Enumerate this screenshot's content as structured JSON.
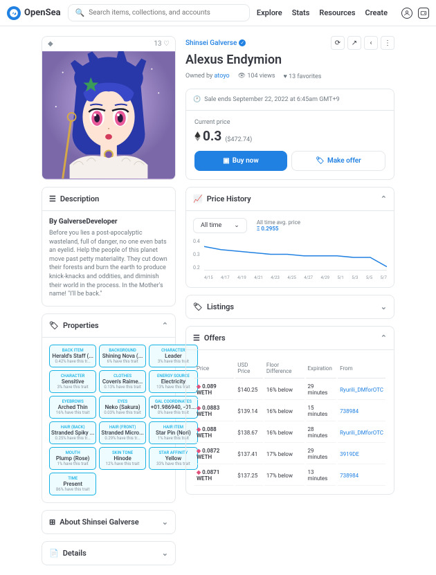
{
  "header": {
    "brand": "OpenSea",
    "search_placeholder": "Search items, collections, and accounts",
    "nav": [
      "Explore",
      "Stats",
      "Resources",
      "Create"
    ]
  },
  "artwork_bar": {
    "chain": "◆",
    "likes": "13 ♡"
  },
  "collection": "Shinsei Galverse",
  "title": "Alexus Endymion",
  "owner_prefix": "Owned by ",
  "owner": "atoyo",
  "views": "104 views",
  "favorites": "13 favorites",
  "sale_end": "Sale ends September 22, 2022 at 6:45am GMT+9",
  "price_label": "Current price",
  "price": "0.3",
  "price_usd": "($472.74)",
  "buy": "Buy now",
  "offer": "Make offer",
  "sections": {
    "description": "Description",
    "properties": "Properties",
    "about": "About Shinsei Galverse",
    "details": "Details",
    "price_history": "Price History",
    "listings": "Listings",
    "offers": "Offers"
  },
  "desc_author": "By GalverseDeveloper",
  "desc_text": "Before you lies a post-apocalyptic wasteland, full of danger, no one even bats an eyelid. Help the people of this planet move past petty materiality. They cut down their forests and burn the earth to produce knick-knacks and oddities, and diminish their world in the process. In the Mother's name! \"I'll be back.\"",
  "properties": [
    {
      "t": "BACK ITEM",
      "v": "Herald's Staff (...",
      "r": "0.42% have this tr..."
    },
    {
      "t": "BACKGROUND",
      "v": "Shining Nova (...",
      "r": "6% have this trait"
    },
    {
      "t": "CHARACTER",
      "v": "Leader",
      "r": "3% have this trait"
    },
    {
      "t": "CHARACTER",
      "v": "Sensitive",
      "r": "3% have this trait"
    },
    {
      "t": "CLOTHES",
      "v": "Coven's Raime...",
      "r": "0.13% have this trait"
    },
    {
      "t": "ENERGY SOURCE",
      "v": "Electricity",
      "r": "13% have this trait"
    },
    {
      "t": "EYEBROWS",
      "v": "Arched Thin",
      "r": "16% have this trait"
    },
    {
      "t": "EYES",
      "v": "Neko (Sakura)",
      "r": "0.03% have this trait"
    },
    {
      "t": "GAL COORDINATES",
      "v": "+01.986940, -01...",
      "r": "0% have this trait"
    },
    {
      "t": "HAIR (BACK)",
      "v": "Stranded Spiky ...",
      "r": "0.25% have this tr..."
    },
    {
      "t": "HAIR (FRONT)",
      "v": "Stranded Micro...",
      "r": "0.29% have this tr..."
    },
    {
      "t": "HAIR ITEM",
      "v": "Star Pin (Nori)",
      "r": "1% have this trait"
    },
    {
      "t": "MOUTH",
      "v": "Plump (Rose)",
      "r": "1% have this trait"
    },
    {
      "t": "SKIN TONE",
      "v": "Hinode",
      "r": "12% have this trait"
    },
    {
      "t": "STAR AFFINITY",
      "v": "Yellow",
      "r": "33% have this trait"
    },
    {
      "t": "TIME",
      "v": "Present",
      "r": "86% have this trait"
    }
  ],
  "time_filter": "All time",
  "avg_label": "All time avg. price",
  "avg_value": "Ξ 0.2955",
  "offers_headers": [
    "Price",
    "USD Price",
    "Floor Difference",
    "Expiration",
    "From"
  ],
  "offers": [
    {
      "p": "0.089 WETH",
      "u": "$140.25",
      "f": "16% below",
      "e": "29 minutes",
      "from": "Ryurili_DMforOTC"
    },
    {
      "p": "0.0883 WETH",
      "u": "$139.14",
      "f": "16% below",
      "e": "15 minutes",
      "from": "738984"
    },
    {
      "p": "0.088 WETH",
      "u": "$138.67",
      "f": "16% below",
      "e": "28 minutes",
      "from": "Ryurili_DMforOTC"
    },
    {
      "p": "0.0872 WETH",
      "u": "$137.41",
      "f": "17% below",
      "e": "29 minutes",
      "from": "3919DE"
    },
    {
      "p": "0.0871 WETH",
      "u": "$137.25",
      "f": "17% below",
      "e": "13 minutes",
      "from": "738984"
    }
  ],
  "chart_data": {
    "type": "line",
    "title": "Price History",
    "xlabel": "",
    "ylabel": "",
    "ylim": [
      0.2,
      0.4
    ],
    "yticks": [
      0.2,
      0.3,
      0.4
    ],
    "x": [
      "4/15",
      "4/17",
      "4/19",
      "4/21",
      "4/23",
      "4/25",
      "4/27",
      "4/29",
      "5/1",
      "5/3",
      "5/5",
      "5/7"
    ],
    "values": [
      0.35,
      0.33,
      0.32,
      0.31,
      0.3,
      0.3,
      0.29,
      0.29,
      0.29,
      0.28,
      0.28,
      0.22
    ],
    "avg": 0.2955
  }
}
